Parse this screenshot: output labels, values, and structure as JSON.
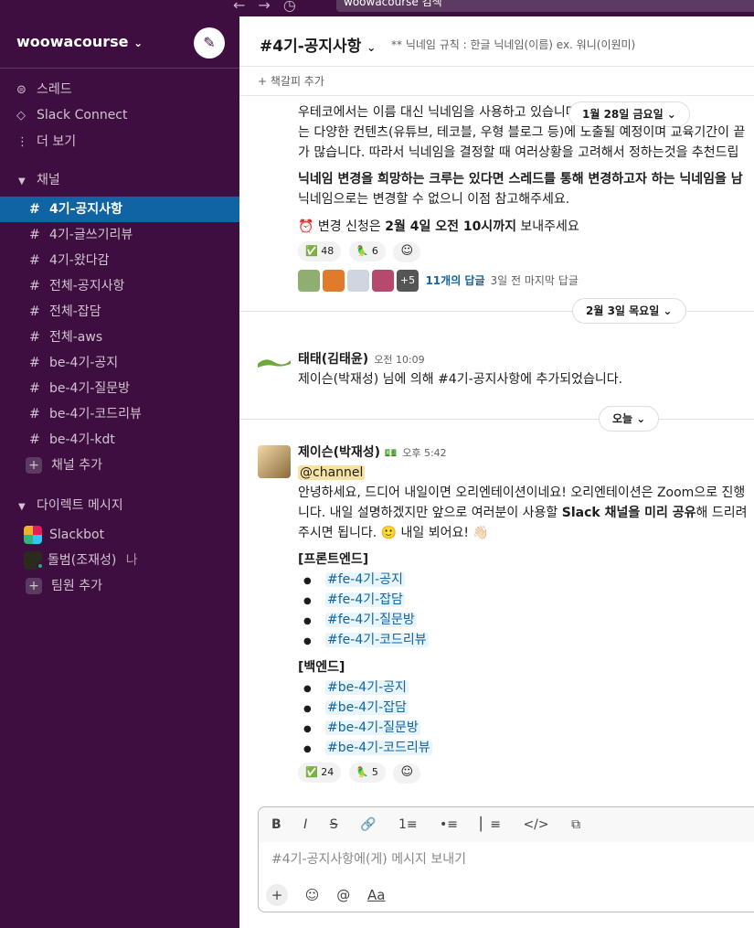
{
  "topbar": {
    "search_text": "woowacourse 검색"
  },
  "workspace": {
    "name": "woowacourse",
    "caret": "⌄"
  },
  "nav": [
    {
      "icon": "threads-icon",
      "label": "스레드"
    },
    {
      "icon": "slack-connect-icon",
      "label": "Slack Connect"
    },
    {
      "icon": "more-icon",
      "label": "더 보기"
    }
  ],
  "channels_section": {
    "label": "채널",
    "add_label": "채널 추가"
  },
  "channels": [
    {
      "name": "4기-공지사항",
      "active": true
    },
    {
      "name": "4기-글쓰기리뷰"
    },
    {
      "name": "4기-왔다감"
    },
    {
      "name": "전체-공지사항"
    },
    {
      "name": "전체-잡담"
    },
    {
      "name": "전체-aws"
    },
    {
      "name": "be-4기-공지"
    },
    {
      "name": "be-4기-질문방"
    },
    {
      "name": "be-4기-코드리뷰"
    },
    {
      "name": "be-4기-kdt"
    }
  ],
  "dm_section": {
    "label": "다이렉트 메시지",
    "add_label": "팀원 추가"
  },
  "dms": [
    {
      "name": "Slackbot",
      "suffix": ""
    },
    {
      "name": "돌범(조재성)",
      "suffix": "나"
    }
  ],
  "channel_header": {
    "title": "#4기-공지사항",
    "caret": "⌄",
    "topic": "** 닉네임 규칙 : 한글 닉네임(이름) ex. 워니(이원미)",
    "bookmark": "+ 책갈피 추가"
  },
  "msg1": {
    "line1": "우테코에서는 이름 대신 닉네임을 사용하고 있습니다. 닉네임의 용도로는",
    "line2": "는 다양한 컨텐츠(유튜브, 테코블, 우형 블로그 등)에 노출될 예정이며 교육기간이 끝",
    "line3": "가 많습니다. 따라서 닉네임을 결정할 때 여러상황을 고려해서 정하는것을 추천드립",
    "line4_bold": "닉네임 변경을 희망하는 크루는 있다면 스레드를 통해 변경하고자 하는 닉네임을 남",
    "line5": "닉네임으로는 변경할 수 없으니 이점 참고해주세요.",
    "deadline_prefix": "변경 신청은 ",
    "deadline_bold": "2월 4일 오전 10시까지",
    "deadline_suffix": " 보내주세요",
    "reactions": [
      {
        "emoji": "✅",
        "count": "48"
      },
      {
        "emoji": "🦜",
        "count": "6"
      }
    ],
    "thread_replies": "11개의 답글",
    "thread_last": "3일 전 마지막 답글",
    "thread_more": "+5"
  },
  "date_pills": {
    "jan28": "1월 28일 금요일 ⌄",
    "feb3": "2월 3일 목요일 ⌄",
    "today": "오늘 ⌄"
  },
  "msg2": {
    "author": "태태(김태윤)",
    "time": "오전 10:09",
    "text": "제이슨(박재성) 님에 의해 #4기-공지사항에 추가되었습니다."
  },
  "msg3": {
    "author": "제이슨(박재성)",
    "author_badge": "💵",
    "time": "오후 5:42",
    "mention": "@channel",
    "line1": "안녕하세요, 드디어 내일이면 오리엔테이션이네요! 오리엔테이션은 Zoom으로 진행",
    "line2_a": "니다. 내일 설명하겠지만 앞으로 여러분이 사용할 ",
    "line2_b": "Slack 채널을 미리 공유",
    "line2_c": "해 드리려",
    "line3": "주시면 됩니다. 🙂 내일 뵈어요! 👋🏻",
    "fe_heading": "[프론트엔드]",
    "fe_channels": [
      "#fe-4기-공지",
      "#fe-4기-잡담",
      "#fe-4기-질문방",
      "#fe-4기-코드리뷰"
    ],
    "be_heading": "[백엔드]",
    "be_channels": [
      "#be-4기-공지",
      "#be-4기-잡담",
      "#be-4기-질문방",
      "#be-4기-코드리뷰"
    ],
    "reactions": [
      {
        "emoji": "✅",
        "count": "24"
      },
      {
        "emoji": "🦜",
        "count": "5"
      }
    ]
  },
  "composer": {
    "placeholder": "#4기-공지사항에(게) 메시지 보내기",
    "toolbar": [
      "B",
      "I",
      "S",
      "🔗",
      "1≡",
      "•≡",
      "▏≡",
      "</>",
      "⧉"
    ],
    "bottom": [
      "+",
      "☺",
      "@",
      "Aa"
    ]
  }
}
